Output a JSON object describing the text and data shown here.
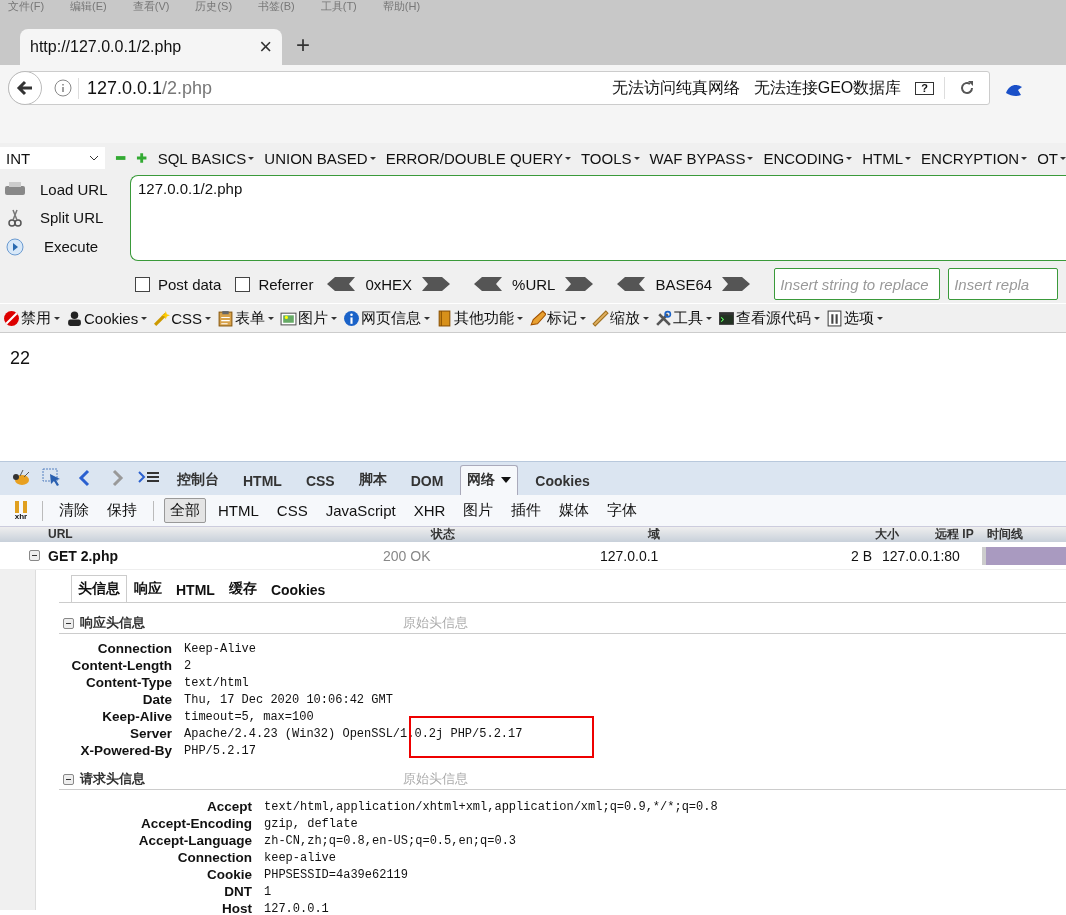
{
  "menu_bar": [
    "文件(F)",
    "编辑(E)",
    "查看(V)",
    "历史(S)",
    "书签(B)",
    "工具(T)",
    "帮助(H)"
  ],
  "browser_tab": {
    "title": "http://127.0.0.1/2.php",
    "close": "×",
    "new_tab": "+"
  },
  "address_bar": {
    "host": "127.0.0.1",
    "path": "/2.php",
    "help": "?",
    "notices": [
      "无法访问纯真网络",
      "无法连接GEO数据库"
    ]
  },
  "hackbar": {
    "select": "INT",
    "menus": [
      "SQL BASICS",
      "UNION BASED",
      "ERROR/DOUBLE QUERY",
      "TOOLS",
      "WAF BYPASS",
      "ENCODING",
      "HTML",
      "ENCRYPTION",
      "OT"
    ],
    "buttons": [
      "Load URL",
      "Split URL",
      "Execute"
    ],
    "url": "127.0.0.1/2.php",
    "options": [
      {
        "label": "Post data",
        "checked": false
      },
      {
        "label": "Referrer",
        "checked": false
      }
    ],
    "encoders": [
      "0xHEX",
      "%URL",
      "BASE64"
    ],
    "replace_fields": [
      {
        "placeholder": "Insert string to replace"
      },
      {
        "placeholder": "Insert repla"
      }
    ]
  },
  "webdev_toolbar": [
    "禁用",
    "Cookies",
    "CSS",
    "表单",
    "图片",
    "网页信息",
    "其他功能",
    "标记",
    "缩放",
    "工具",
    "查看源代码",
    "选项"
  ],
  "page_content": "22",
  "firebug": {
    "xhr_label": "xhr",
    "panel_tabs": [
      {
        "label": "控制台",
        "selected": false
      },
      {
        "label": "HTML",
        "selected": false
      },
      {
        "label": "CSS",
        "selected": false
      },
      {
        "label": "脚本",
        "selected": false
      },
      {
        "label": "DOM",
        "selected": false
      },
      {
        "label": "网络",
        "selected": true
      },
      {
        "label": "Cookies",
        "selected": false
      }
    ],
    "actions": [
      "清除",
      "保持"
    ],
    "filters": [
      {
        "label": "全部",
        "selected": true
      },
      {
        "label": "HTML",
        "selected": false
      },
      {
        "label": "CSS",
        "selected": false
      },
      {
        "label": "JavaScript",
        "selected": false
      },
      {
        "label": "XHR",
        "selected": false
      },
      {
        "label": "图片",
        "selected": false
      },
      {
        "label": "插件",
        "selected": false
      },
      {
        "label": "媒体",
        "selected": false
      },
      {
        "label": "字体",
        "selected": false
      }
    ],
    "columns": [
      "URL",
      "状态",
      "域",
      "大小",
      "远程 IP",
      "时间线"
    ],
    "request": {
      "expanded": true,
      "url": "GET 2.php",
      "status": "200 OK",
      "domain": "127.0.0.1",
      "size": "2 B",
      "remote_ip": "127.0.0.1:80"
    },
    "detail_tabs": [
      {
        "label": "头信息",
        "selected": true
      },
      {
        "label": "响应",
        "selected": false
      },
      {
        "label": "HTML",
        "selected": false
      },
      {
        "label": "缓存",
        "selected": false
      },
      {
        "label": "Cookies",
        "selected": false
      }
    ],
    "sections": [
      {
        "title": "响应头信息",
        "link": "原始头信息",
        "expanded": true,
        "headers": [
          {
            "name": "Connection",
            "value": "Keep-Alive",
            "highlighted": false
          },
          {
            "name": "Content-Length",
            "value": "2",
            "highlighted": false
          },
          {
            "name": "Content-Type",
            "value": "text/html",
            "highlighted": false
          },
          {
            "name": "Date",
            "value": "Thu, 17 Dec 2020 10:06:42 GMT",
            "highlighted": false
          },
          {
            "name": "Keep-Alive",
            "value": "timeout=5, max=100",
            "highlighted": false
          },
          {
            "name": "Server",
            "value": "Apache/2.4.23 (Win32) OpenSSL/1.0.2j PHP/5.2.17",
            "highlighted": true
          },
          {
            "name": "X-Powered-By",
            "value": "PHP/5.2.17",
            "highlighted": false
          }
        ]
      },
      {
        "title": "请求头信息",
        "link": "原始头信息",
        "expanded": true,
        "headers": [
          {
            "name": "Accept",
            "value": "text/html,application/xhtml+xml,application/xml;q=0.9,*/*;q=0.8",
            "highlighted": false
          },
          {
            "name": "Accept-Encoding",
            "value": "gzip, deflate",
            "highlighted": false
          },
          {
            "name": "Accept-Language",
            "value": "zh-CN,zh;q=0.8,en-US;q=0.5,en;q=0.3",
            "highlighted": false
          },
          {
            "name": "Connection",
            "value": "keep-alive",
            "highlighted": false
          },
          {
            "name": "Cookie",
            "value": "PHPSESSID=4a39e62119",
            "highlighted": false
          },
          {
            "name": "DNT",
            "value": "1",
            "highlighted": false
          },
          {
            "name": "Host",
            "value": "127.0.0.1",
            "highlighted": false
          }
        ]
      }
    ]
  }
}
